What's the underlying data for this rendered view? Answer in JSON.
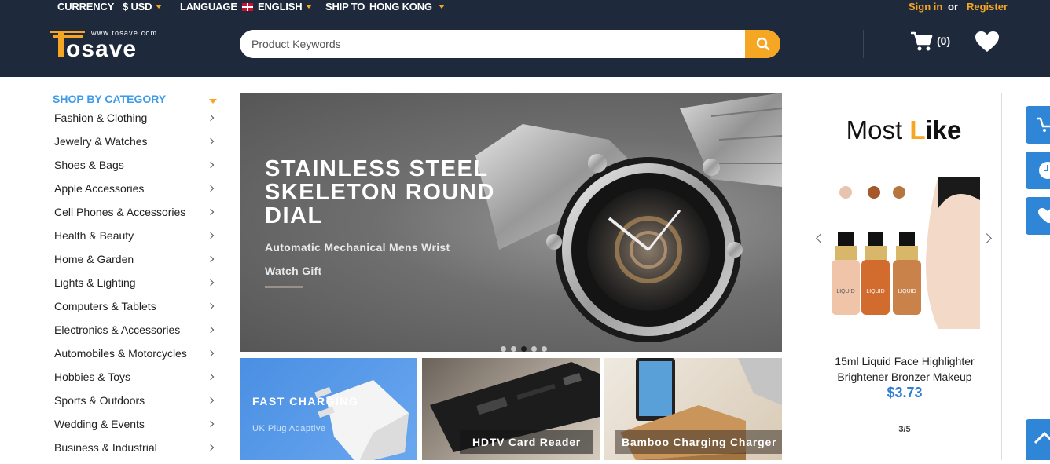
{
  "header": {
    "currency_label": "CURRENCY",
    "currency_value": "$ USD",
    "language_label": "LANGUAGE",
    "language_value": "ENGLISH",
    "ship_label": "SHIP TO",
    "ship_value": "HONG KONG",
    "sign_in": "Sign in",
    "or": "or",
    "register": "Register",
    "logo_tagline": "www.tosave.com",
    "logo_text": "TOSAVE",
    "search_placeholder": "Product Keywords",
    "cart_count": "(0)",
    "accent_color": "#f5a623",
    "bar_color": "#1e2a3b"
  },
  "sidebar": {
    "title": "SHOP BY CATEGORY",
    "items": [
      "Fashion & Clothing",
      "Jewelry & Watches",
      "Shoes & Bags",
      "Apple Accessories",
      "Cell Phones & Accessories",
      "Health & Beauty",
      "Home & Garden",
      "Lights & Lighting",
      "Computers & Tablets",
      "Electronics & Accessories",
      "Automobiles & Motorcycles",
      "Hobbies & Toys",
      "Sports & Outdoors",
      "Wedding & Events",
      "Business & Industrial"
    ]
  },
  "banner": {
    "title": "STAINLESS STEEL SKELETON ROUND DIAL",
    "subtitle": "Automatic Mechanical Mens Wrist Watch Gift",
    "slide_count": 5,
    "active_slide": 3
  },
  "tiles": [
    {
      "label": "FAST CHARGING",
      "sublabel": "UK Plug Adaptive"
    },
    {
      "label": "HDTV Card Reader"
    },
    {
      "label": "Bamboo Charging Charger"
    }
  ],
  "most_like": {
    "title_pre": "Most ",
    "title_l": "L",
    "title_rest": "ike",
    "product_name": "15ml Liquid Face Highlighter Brightener Bronzer Makeup",
    "price": "$3.73",
    "pager": "3/5",
    "bottle_label": "LIQUID"
  },
  "side_buttons": [
    "cart-icon",
    "clock-icon",
    "heart-icon"
  ],
  "back_to_top": "chevron-up-icon"
}
